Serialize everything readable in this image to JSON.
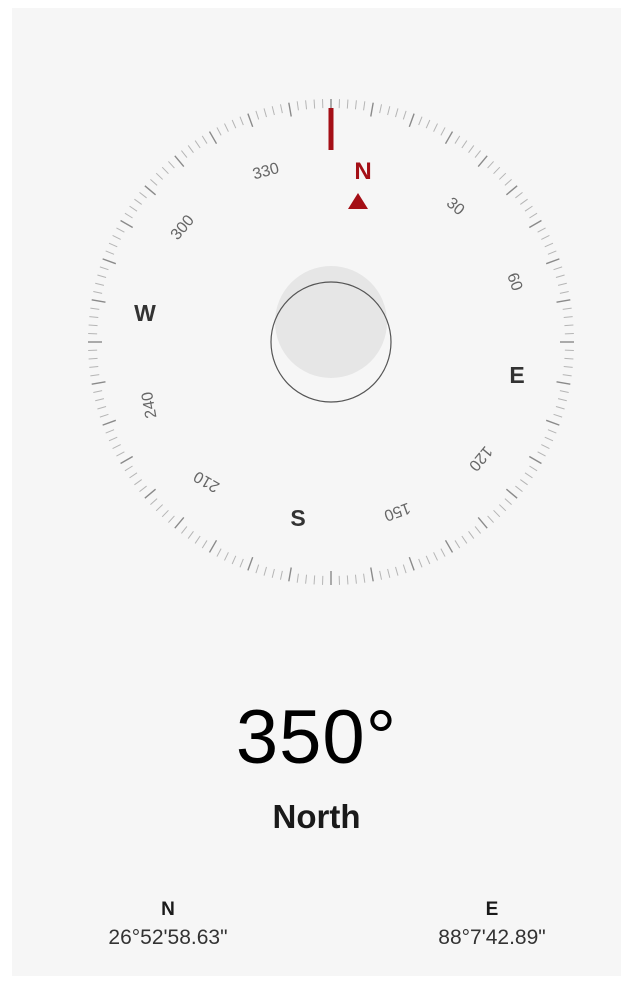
{
  "compass": {
    "needle_color": "#a40f16",
    "cardinal": {
      "north": "N",
      "east": "E",
      "south": "S",
      "west": "W"
    },
    "degree_labels": [
      "30",
      "60",
      "120",
      "150",
      "210",
      "240",
      "300",
      "330"
    ],
    "heading_deg": 350
  },
  "readout": {
    "heading": "350°",
    "direction": "North"
  },
  "location": {
    "latitude_label": "N",
    "latitude_value": "26°52'58.63\"",
    "longitude_label": "E",
    "longitude_value": "88°7'42.89\""
  }
}
